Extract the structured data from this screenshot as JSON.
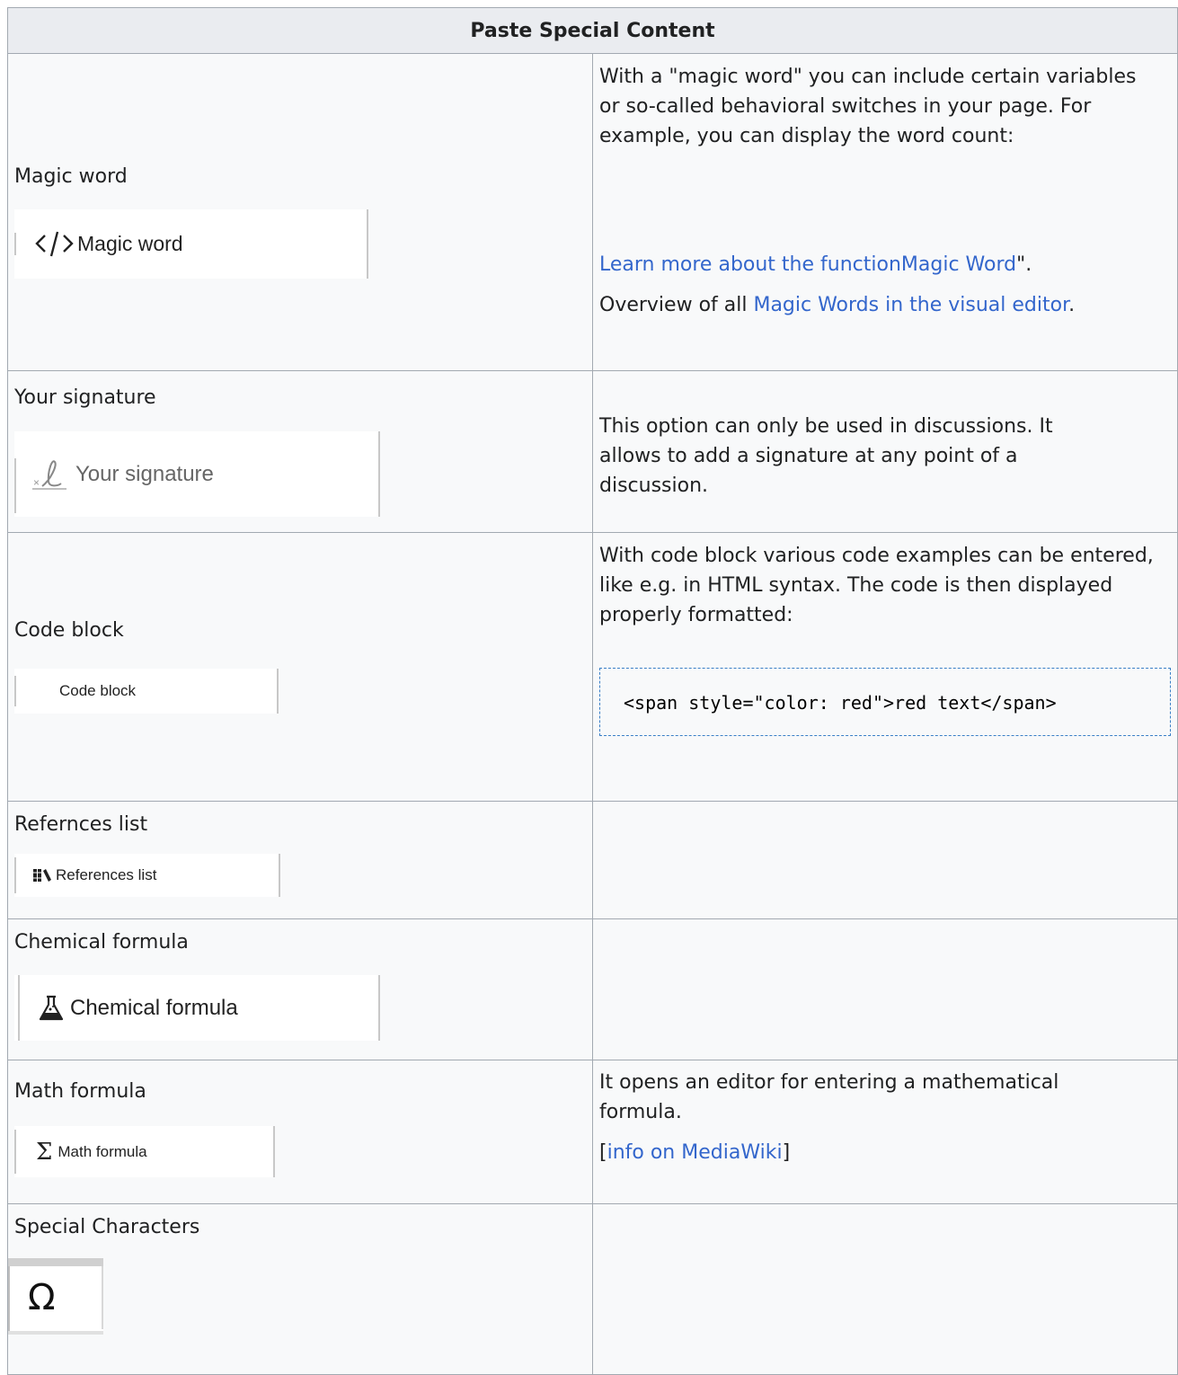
{
  "table": {
    "header": "Paste Special Content",
    "rows": {
      "magic": {
        "label": "Magic word",
        "button_label": "Magic word",
        "icon": "code-brackets-icon",
        "desc": "With a \"magic word\" you can include certain variables or so-called behavioral switches in your page. For example, you can display the word count:",
        "learn_link": "Learn more about the functionMagic Word",
        "learn_suffix": "\".",
        "overview_prefix": "Overview of all ",
        "overview_link": "Magic Words in the visual editor",
        "overview_suffix": "."
      },
      "signature": {
        "label": "Your signature",
        "button_label": "Your signature",
        "icon": "signature-icon",
        "desc": "This option can only be used in discussions. It allows to add a signature at any point of a discussion."
      },
      "code": {
        "label": "Code block",
        "button_label": "Code block",
        "desc": "With code block various code examples can be entered, like e.g. in HTML syntax. The code is then displayed properly formatted:",
        "code": "<span style=\"color: red\">red text</span>"
      },
      "references": {
        "label": "Refernces list",
        "button_label": "References list",
        "icon": "books-icon"
      },
      "chemical": {
        "label": "Chemical formula",
        "button_label": "Chemical formula",
        "icon": "flask-icon"
      },
      "math": {
        "label": "Math formula",
        "button_label": "Math formula",
        "icon": "sigma-icon",
        "desc": "It opens an editor for entering a mathematical formula.",
        "link_open": "[",
        "link": "info on MediaWiki",
        "link_close": "]"
      },
      "special": {
        "label": "Special Characters",
        "icon": "omega-icon",
        "glyph": "Ω"
      }
    }
  },
  "colors": {
    "link": "#3366cc",
    "border": "#a2a9b1",
    "header_bg": "#eaecf0",
    "cell_bg": "#f8f9fa",
    "code_border": "#3a7fc6"
  }
}
